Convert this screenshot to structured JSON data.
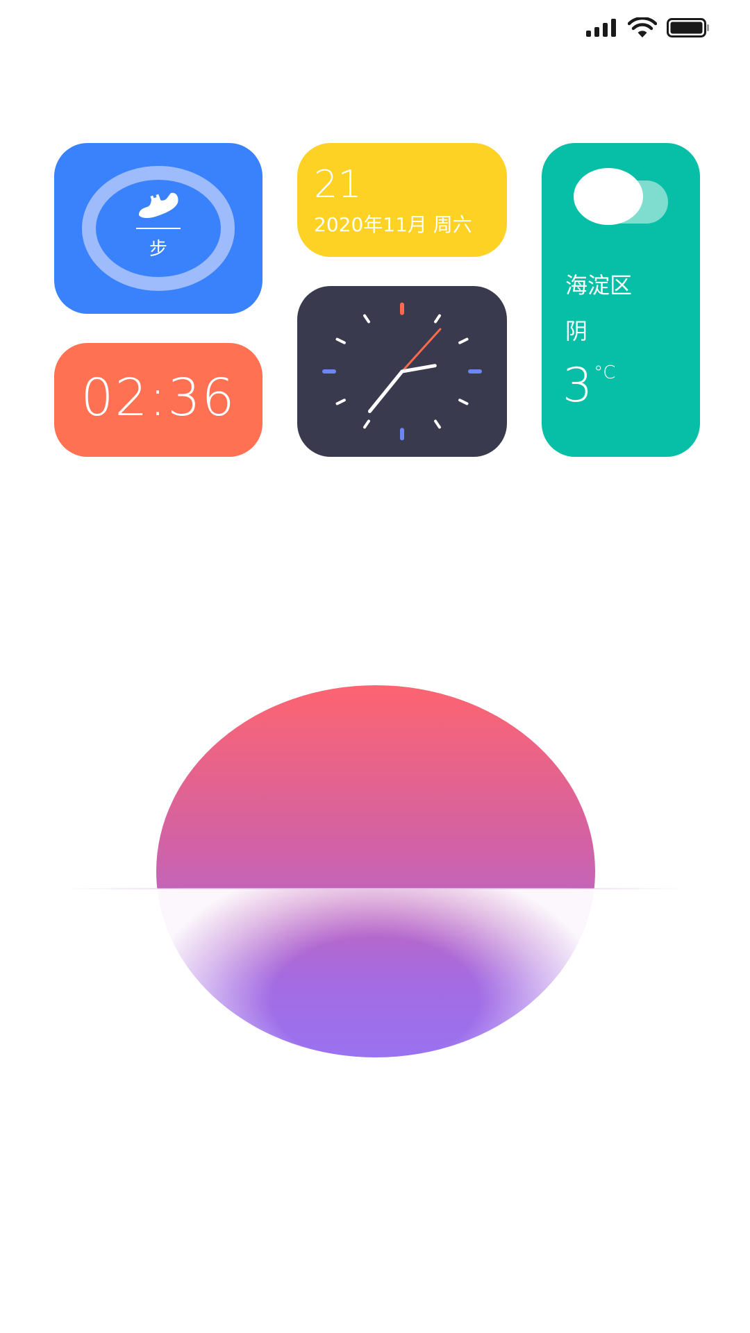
{
  "colors": {
    "steps_card": "#3a82fc",
    "time_card": "#ff7152",
    "date_card": "#fed224",
    "clock_card": "#3a3a4e",
    "weather_card": "#06bfa6",
    "clock_accent_red": "#ff6a4d",
    "clock_accent_blue": "#6f86f2",
    "sun_top": "#fd6470",
    "sun_bottom": "#9a72f0"
  },
  "status_bar": {
    "icons": [
      "signal-icon",
      "wifi-icon",
      "battery-icon"
    ]
  },
  "steps_widget": {
    "icon": "sneaker-icon",
    "label": "步"
  },
  "time_widget": {
    "time": "02:36"
  },
  "date_widget": {
    "day": "21",
    "date_line": "2020年11月 周六"
  },
  "clock_widget": {
    "hour": 2,
    "minute": 36,
    "second_hand_minute": 7
  },
  "weather_widget": {
    "icon": "cloud-icon",
    "location": "海淀区",
    "condition": "阴",
    "temperature": "3",
    "unit": "°C"
  },
  "decoration": {
    "shape": "sunset-sun"
  }
}
